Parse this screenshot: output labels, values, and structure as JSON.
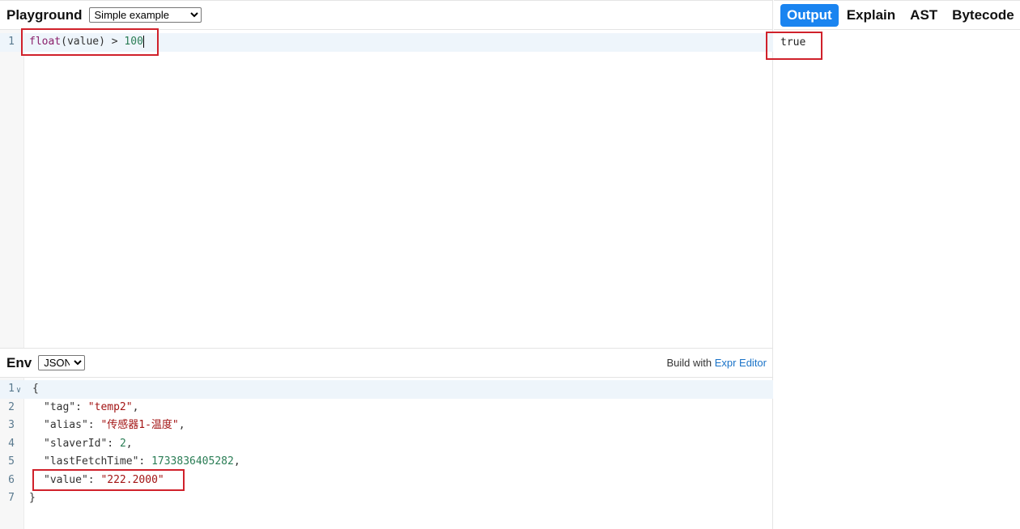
{
  "playground": {
    "title": "Playground",
    "example_selected": "Simple example"
  },
  "expression": {
    "lines": [
      {
        "number": "1",
        "fn": "float",
        "open": "(value)",
        "op": " > ",
        "num": "100"
      }
    ]
  },
  "env": {
    "title": "Env",
    "format_selected": "JSON",
    "build_prefix": "Build with ",
    "build_link": "Expr Editor",
    "line_numbers": [
      "1",
      "2",
      "3",
      "4",
      "5",
      "6",
      "7"
    ],
    "lines": {
      "l1": "{",
      "l2_key": "\"tag\"",
      "l2_val": "\"temp2\"",
      "l3_key": "\"alias\"",
      "l3_val": "\"传感器1-温度\"",
      "l4_key": "\"slaverId\"",
      "l4_val": "2",
      "l5_key": "\"lastFetchTime\"",
      "l5_val": "1733836405282",
      "l6_key": "\"value\"",
      "l6_val": "\"222.2000\"",
      "l7": "}"
    }
  },
  "tabs": [
    "Output",
    "Explain",
    "AST",
    "Bytecode"
  ],
  "active_tab": "Output",
  "output": {
    "text": "true"
  },
  "colors": {
    "accent": "#1a84f0",
    "annotation": "#d0212b"
  }
}
